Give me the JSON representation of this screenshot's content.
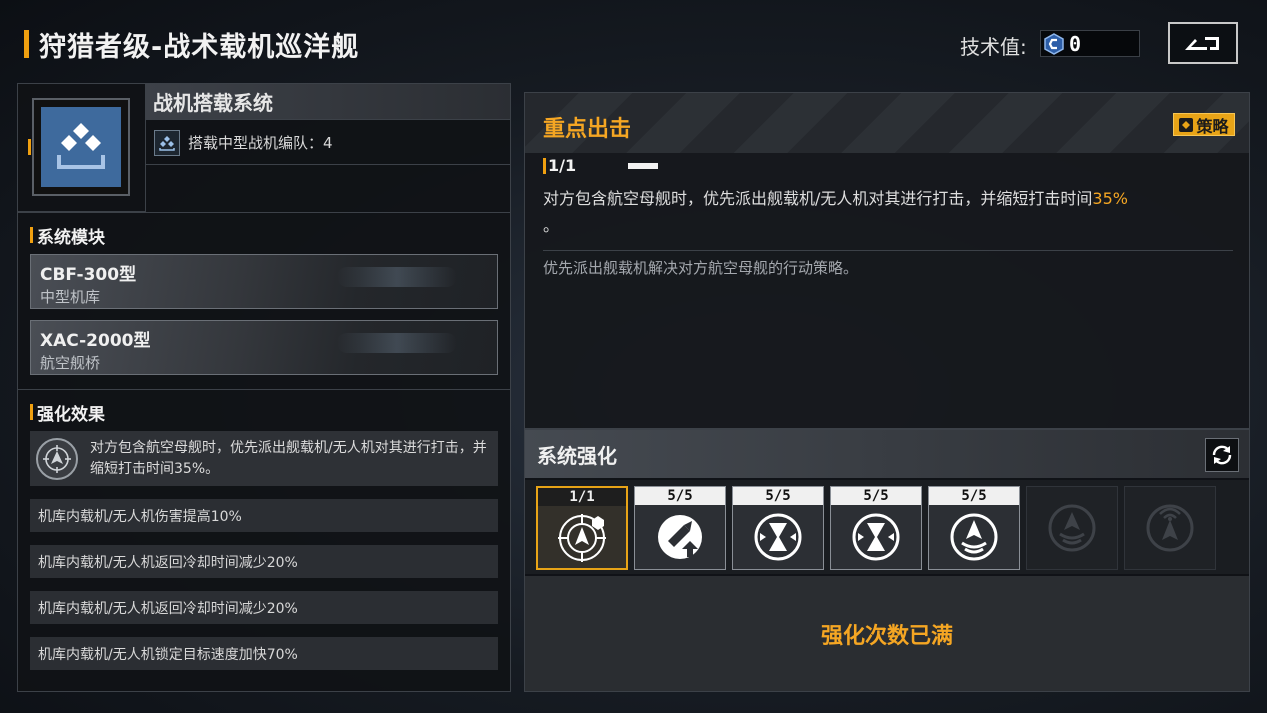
{
  "header": {
    "title": "狩猎者级-战术载机巡洋舰",
    "tech_label": "技术值:",
    "tech_value": "0"
  },
  "system": {
    "name": "战机搭载系统",
    "detail": "搭载中型战机编队：4"
  },
  "modules": {
    "heading": "系统模块",
    "items": [
      {
        "model": "CBF-300型",
        "kind": "中型机库"
      },
      {
        "model": "XAC-2000型",
        "kind": "航空舰桥"
      }
    ]
  },
  "effects": {
    "heading": "强化效果",
    "main": "对方包含航空母舰时，优先派出舰载机/无人机对其进行打击，并缩短打击时间35%。",
    "items": [
      "机库内载机/无人机伤害提高10%",
      "机库内载机/无人机返回冷却时间减少20%",
      "机库内载机/无人机返回冷却时间减少20%",
      "机库内载机/无人机锁定目标速度加快70%"
    ]
  },
  "skill": {
    "title": "重点出击",
    "strategy_label": "策略",
    "level": "1/1",
    "desc_main": "对方包含航空母舰时，优先派出舰载机/无人机对其进行打击，并缩短打击时间",
    "desc_highlight": "35%",
    "desc_end": "。",
    "flavor": "优先派出舰载机解决对方航空母舰的行动策略。"
  },
  "upgrade": {
    "heading": "系统强化",
    "slots": [
      {
        "count": "1/1",
        "icon": "target-plane-icon",
        "state": "active"
      },
      {
        "count": "5/5",
        "icon": "damage-up-icon",
        "state": "done"
      },
      {
        "count": "5/5",
        "icon": "cooldown-icon",
        "state": "done"
      },
      {
        "count": "5/5",
        "icon": "cooldown-icon",
        "state": "done"
      },
      {
        "count": "5/5",
        "icon": "lock-speed-icon",
        "state": "done"
      },
      {
        "count": "",
        "icon": "signal-plane-icon",
        "state": "locked"
      },
      {
        "count": "",
        "icon": "radar-plane-icon",
        "state": "locked"
      }
    ],
    "max_message": "强化次数已满"
  },
  "colors": {
    "accent": "#f0a010",
    "highlight": "#f5a623",
    "icon_blue": "#3e6a9d"
  }
}
